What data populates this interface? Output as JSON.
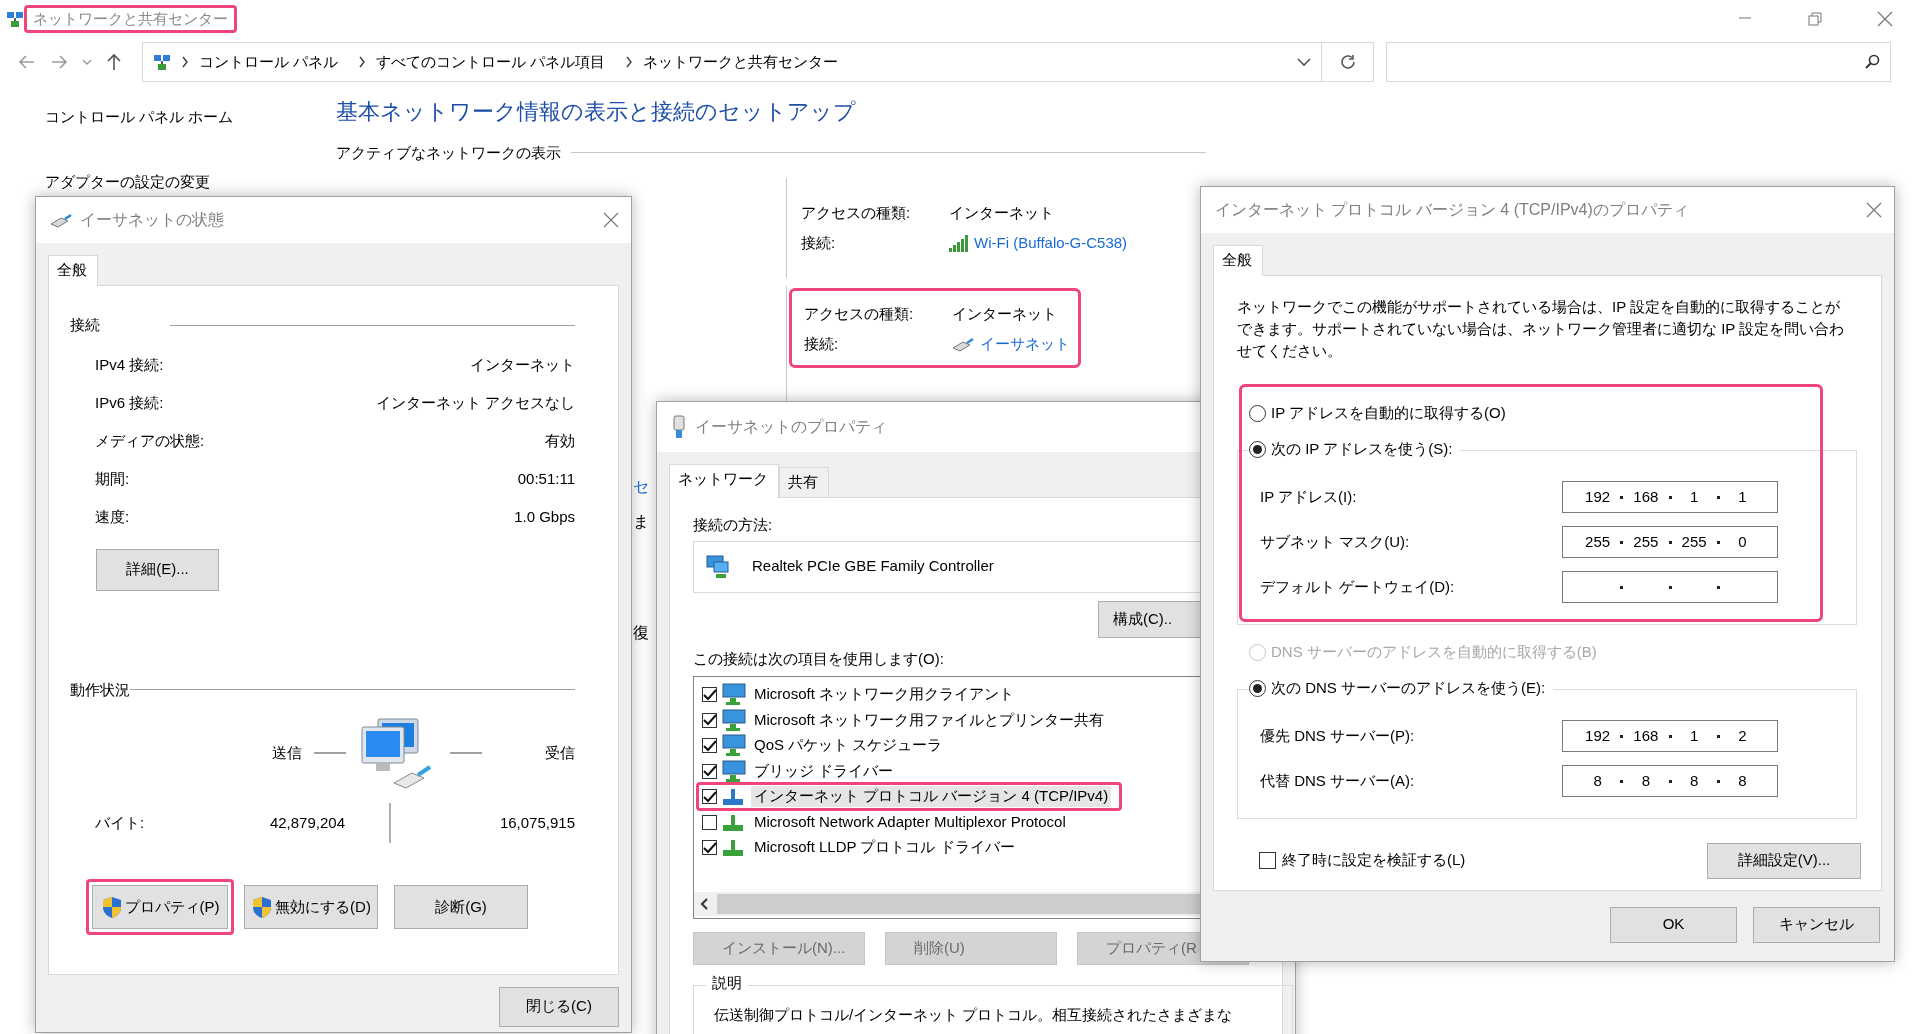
{
  "window": {
    "title": "ネットワークと共有センター",
    "highlighted": true
  },
  "address_bar": {
    "breadcrumbs": [
      "コントロール パネル",
      "すべてのコントロール パネル項目",
      "ネットワークと共有センター"
    ]
  },
  "sidebar": {
    "items": [
      "コントロール パネル ホーム",
      "アダプターの設定の変更"
    ]
  },
  "heading": "基本ネットワーク情報の表示と接続のセットアップ",
  "section_title": "アクティブなネットワークの表示",
  "networks": [
    {
      "kind": "wifi",
      "access_label": "アクセスの種類:",
      "access": "インターネット",
      "connection_label": "接続:",
      "connection": "Wi-Fi (Buffalo-G-C538)",
      "highlighted": false
    },
    {
      "kind": "ethernet",
      "access_label": "アクセスの種類:",
      "access": "インターネット",
      "connection_label": "接続:",
      "connection": "イーサネット",
      "highlighted": true
    }
  ],
  "partial_texts": [
    {
      "kind": "link",
      "text": "セ"
    },
    {
      "kind": "text",
      "text": "ま"
    },
    {
      "kind": "text",
      "text": "復"
    }
  ],
  "status_dialog": {
    "title": "イーサネットの状態",
    "tabs": [
      {
        "label": "全般",
        "selected": true
      }
    ],
    "connection_section": "接続",
    "rows": [
      {
        "label": "IPv4 接続:",
        "value": "インターネット"
      },
      {
        "label": "IPv6 接続:",
        "value": "インターネット アクセスなし"
      },
      {
        "label": "メディアの状態:",
        "value": "有効"
      },
      {
        "label": "期間:",
        "value": "00:51:11"
      },
      {
        "label": "速度:",
        "value": "1.0 Gbps"
      }
    ],
    "details_button": "詳細(E)...",
    "activity_section": "動作状況",
    "sent_label": "送信",
    "received_label": "受信",
    "bytes_label": "バイト:",
    "bytes_sent": "42,879,204",
    "bytes_received": "16,075,915",
    "buttons": [
      {
        "label": "プロパティ(P)",
        "shield": true,
        "highlighted": true
      },
      {
        "label": "無効にする(D)",
        "shield": true,
        "highlighted": false
      },
      {
        "label": "診断(G)",
        "shield": false,
        "highlighted": false
      }
    ],
    "close_button": "閉じる(C)"
  },
  "properties_dialog": {
    "title": "イーサネットのプロパティ",
    "tabs": [
      {
        "label": "ネットワーク",
        "selected": true
      },
      {
        "label": "共有",
        "selected": false
      }
    ],
    "connect_using_label": "接続の方法:",
    "adapter": "Realtek PCIe GBE Family Controller",
    "configure_button": "構成(C)..",
    "items_label": "この接続は次の項目を使用します(O):",
    "items": [
      {
        "kind": "computer",
        "label": "Microsoft ネットワーク用クライアント",
        "checked": true,
        "selected": false,
        "highlighted": false
      },
      {
        "kind": "computer",
        "label": "Microsoft ネットワーク用ファイルとプリンター共有",
        "checked": true,
        "selected": false,
        "highlighted": false
      },
      {
        "kind": "computer",
        "label": "QoS パケット スケジューラ",
        "checked": true,
        "selected": false,
        "highlighted": false
      },
      {
        "kind": "computer",
        "label": "ブリッジ ドライバー",
        "checked": true,
        "selected": false,
        "highlighted": false
      },
      {
        "kind": "protocol",
        "label": "インターネット プロトコル バージョン 4 (TCP/IPv4)",
        "checked": true,
        "selected": true,
        "highlighted": true
      },
      {
        "kind": "protocol",
        "label": "Microsoft Network Adapter Multiplexor Protocol",
        "checked": false,
        "selected": false,
        "highlighted": false
      },
      {
        "kind": "protocol",
        "label": "Microsoft LLDP プロトコル ドライバー",
        "checked": true,
        "selected": false,
        "highlighted": false
      }
    ],
    "buttons": [
      {
        "label": "インストール(N)...",
        "disabled": true
      },
      {
        "label": "削除(U)",
        "disabled": true
      },
      {
        "label": "プロパティ(R",
        "disabled": true
      }
    ],
    "description_label": "説明",
    "description": "伝送制御プロトコル/インターネット プロトコル。相互接続されたさまざまな"
  },
  "ipv4_dialog": {
    "title": "インターネット プロトコル バージョン 4 (TCP/IPv4)のプロパティ",
    "tabs": [
      {
        "label": "全般",
        "selected": true
      }
    ],
    "description": "ネットワークでこの機能がサポートされている場合は、IP 設定を自動的に取得することができます。サポートされていない場合は、ネットワーク管理者に適切な IP 設定を問い合わせてください。",
    "ip_highlighted": true,
    "ip_mode": [
      {
        "label": "IP アドレスを自動的に取得する(O)",
        "selected": false,
        "disabled": false
      },
      {
        "label": "次の IP アドレスを使う(S):",
        "selected": true,
        "disabled": false
      }
    ],
    "ip_fields": [
      {
        "label": "IP アドレス(I):",
        "octets": [
          "192",
          "168",
          "1",
          "1"
        ]
      },
      {
        "label": "サブネット マスク(U):",
        "octets": [
          "255",
          "255",
          "255",
          "0"
        ]
      },
      {
        "label": "デフォルト ゲートウェイ(D):"
      }
    ],
    "dns_mode": [
      {
        "label": "DNS サーバーのアドレスを自動的に取得する(B)",
        "selected": false,
        "disabled": true
      },
      {
        "label": "次の DNS サーバーのアドレスを使う(E):",
        "selected": true,
        "disabled": false
      }
    ],
    "dns_fields": [
      {
        "label": "優先 DNS サーバー(P):",
        "octets": [
          "192",
          "168",
          "1",
          "2"
        ]
      },
      {
        "label": "代替 DNS サーバー(A):",
        "octets": [
          "8",
          "8",
          "8",
          "8"
        ]
      }
    ],
    "validate_checkbox": {
      "label": "終了時に設定を検証する(L)",
      "checked": false
    },
    "advanced_button": "詳細設定(V)...",
    "ok_button": "OK",
    "cancel_button": "キャンセル"
  }
}
